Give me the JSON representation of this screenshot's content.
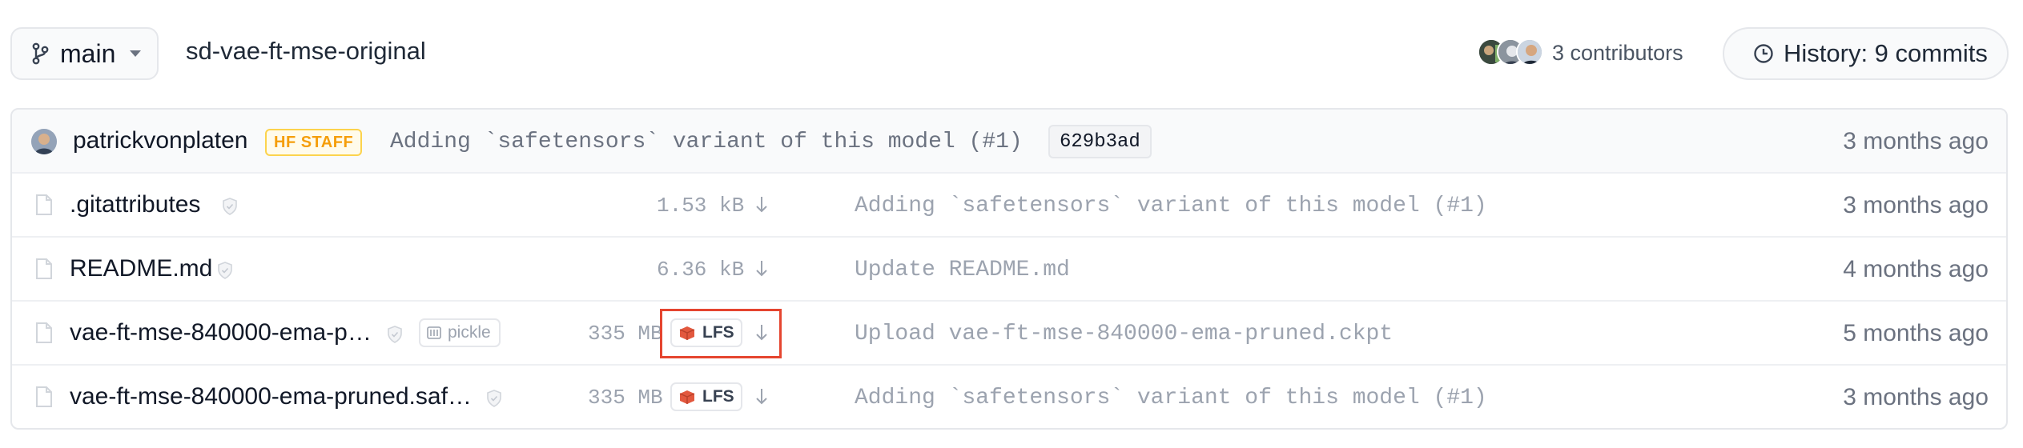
{
  "branch": {
    "label": "main"
  },
  "repo": {
    "name": "sd-vae-ft-mse-original"
  },
  "contributors": {
    "label": "3 contributors"
  },
  "history": {
    "label": "History: 9 commits"
  },
  "last_commit": {
    "author": "patrickvonplaten",
    "badge": "HF STAFF",
    "message": "Adding `safetensors` variant of this model (#1)",
    "sha": "629b3ad",
    "date": "3 months ago"
  },
  "files": [
    {
      "name": ".gitattributes",
      "size": "1.53 kB",
      "message": "Adding `safetensors` variant of this model (#1)",
      "date": "3 months ago"
    },
    {
      "name": "README.md",
      "size": "6.36 kB",
      "message": "Update README.md",
      "date": "4 months ago"
    },
    {
      "name": "vae-ft-mse-840000-ema-p…",
      "tag": "pickle",
      "size": "335 MB",
      "lfs": "LFS",
      "message": "Upload vae-ft-mse-840000-ema-pruned.ckpt",
      "date": "5 months ago"
    },
    {
      "name": "vae-ft-mse-840000-ema-pruned.saf…",
      "size": "335 MB",
      "lfs": "LFS",
      "message": "Adding `safetensors` variant of this model (#1)",
      "date": "3 months ago"
    }
  ],
  "icons": {
    "branch": "git-branch-icon",
    "history": "clock-icon",
    "file": "file-icon",
    "safe": "shield-check-icon",
    "download": "download-arrow-icon",
    "lfs": "lfs-cube-icon",
    "pickle": "pickle-icon"
  },
  "colors": {
    "highlight": "#e5452f",
    "staff_badge": "#f59e0b",
    "lfs_icon": "#e2583e"
  }
}
